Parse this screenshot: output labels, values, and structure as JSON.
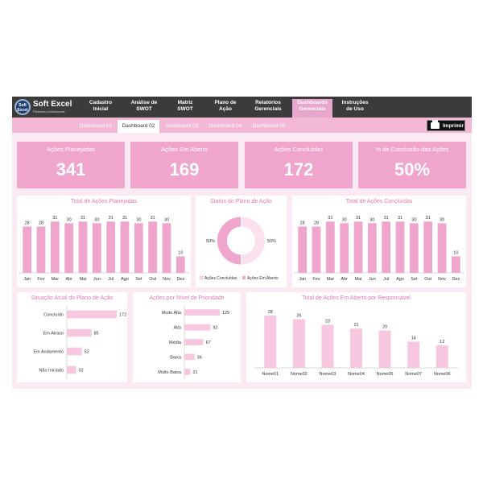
{
  "brand": {
    "title": "Soft Excel",
    "subtitle": "Planilhas profissionais",
    "badge": "Soft Excel"
  },
  "nav": [
    {
      "label": "Cadastro\nInicial",
      "active": false
    },
    {
      "label": "Análise de\nSWOT",
      "active": false
    },
    {
      "label": "Matriz\nSWOT",
      "active": false
    },
    {
      "label": "Plano de\nAção",
      "active": false
    },
    {
      "label": "Relatórios\nGerenciais",
      "active": false
    },
    {
      "label": "Dashboards\nGerenciais",
      "active": true
    },
    {
      "label": "Instruções\nde Uso",
      "active": false
    }
  ],
  "subtabs": [
    {
      "label": "Dashboard 01",
      "active": false
    },
    {
      "label": "Dashboard 02",
      "active": true
    },
    {
      "label": "Dashboard 03",
      "active": false
    },
    {
      "label": "Dashboard 04",
      "active": false
    },
    {
      "label": "Dashboard 05",
      "active": false
    }
  ],
  "print_label": "Imprimir",
  "kpis": [
    {
      "label": "Ações Planejadas",
      "value": "341"
    },
    {
      "label": "Ações Em Aberto",
      "value": "169"
    },
    {
      "label": "Ações Concluídas",
      "value": "172"
    },
    {
      "label": "% de Conclusão das Ações",
      "value": "50%"
    }
  ],
  "colors": {
    "bar": "#f0a6cc",
    "bar_light": "#f7c6df",
    "accent": "#e079b0",
    "nav_bg": "#3b3b3b"
  },
  "chart_data": [
    {
      "type": "bar",
      "title": "Total de Ações Planejadas",
      "categories": [
        "Jan",
        "Fev",
        "Mar",
        "Abr",
        "Mai",
        "Jun",
        "Jul",
        "Ago",
        "Set",
        "Out",
        "Nov",
        "Dez"
      ],
      "values": [
        28,
        28,
        31,
        30,
        31,
        30,
        31,
        31,
        30,
        31,
        30,
        10
      ]
    },
    {
      "type": "pie",
      "title": "Status do Plano de Ação",
      "labels": [
        "Ações Concluídas",
        "Ações Em Aberto"
      ],
      "values": [
        50,
        50
      ],
      "display": [
        "50%",
        "50%"
      ],
      "legend": "bottom"
    },
    {
      "type": "bar",
      "title": "Total de Ações Concluídas",
      "categories": [
        "Jan",
        "Fev",
        "Mar",
        "Abr",
        "Mai",
        "Jun",
        "Jul",
        "Ago",
        "Set",
        "Out",
        "Nov",
        "Dez"
      ],
      "values": [
        28,
        28,
        31,
        30,
        31,
        30,
        31,
        31,
        30,
        31,
        30,
        10
      ]
    },
    {
      "type": "bar",
      "orientation": "horizontal",
      "title": "Situação Atual do Plano de Ação",
      "categories": [
        "Concluído",
        "Em Atraso",
        "Em Andamento",
        "Não Iniciado"
      ],
      "values": [
        172,
        85,
        52,
        32
      ]
    },
    {
      "type": "bar",
      "orientation": "horizontal",
      "title": "Ações por Nível de Prioridade",
      "categories": [
        "Muito Alta",
        "Alta",
        "Média",
        "Baixa",
        "Muito Baixa"
      ],
      "values": [
        125,
        92,
        67,
        36,
        21
      ]
    },
    {
      "type": "bar",
      "title": "Total de Ações Em Aberto por Responsável",
      "categories": [
        "Nome01",
        "Nome02",
        "Nome03",
        "Nome04",
        "Nome05",
        "Nome07",
        "Nome06"
      ],
      "values": [
        28,
        26,
        23,
        21,
        20,
        14,
        12
      ]
    }
  ]
}
